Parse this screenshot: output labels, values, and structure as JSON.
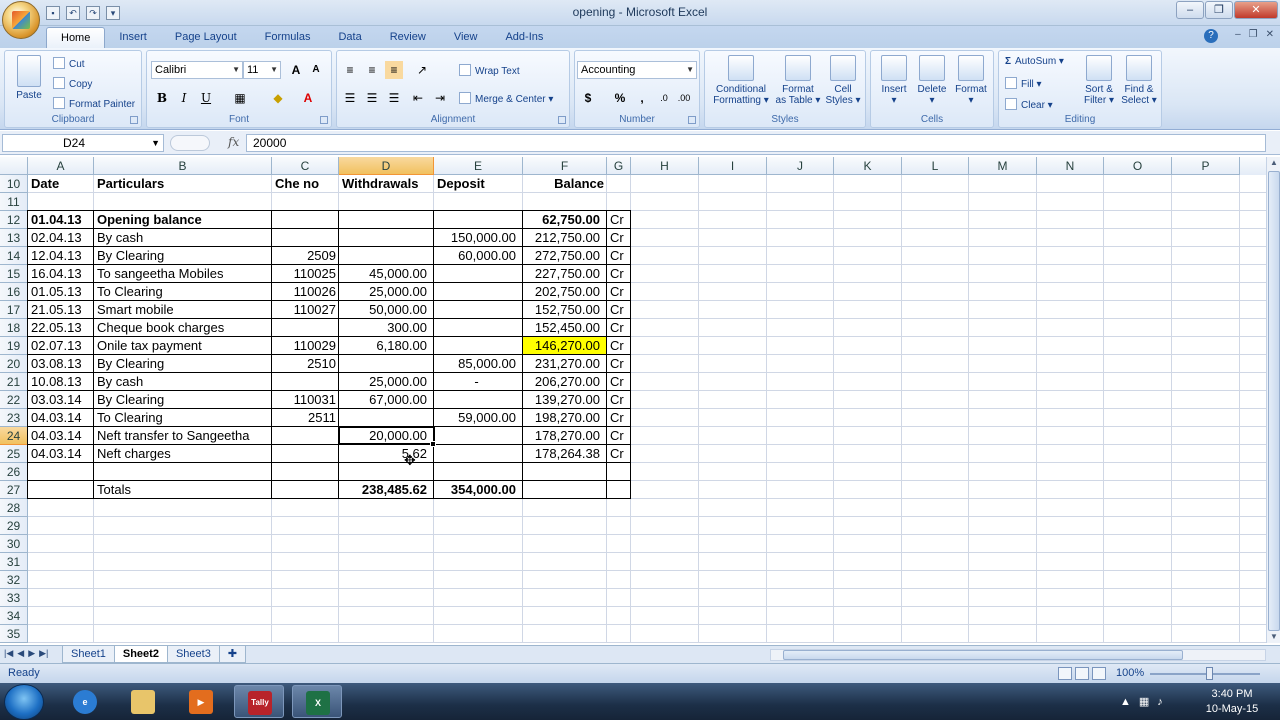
{
  "window": {
    "title": "opening - Microsoft Excel"
  },
  "ribbon_tabs": [
    "Home",
    "Insert",
    "Page Layout",
    "Formulas",
    "Data",
    "Review",
    "View",
    "Add-Ins"
  ],
  "active_tab": "Home",
  "clipboard": {
    "paste": "Paste",
    "cut": "Cut",
    "copy": "Copy",
    "format_painter": "Format Painter",
    "group": "Clipboard"
  },
  "font": {
    "name": "Calibri",
    "size": "11",
    "group": "Font",
    "bold": "B",
    "italic": "I",
    "underline": "U",
    "grow": "A",
    "shrink": "A"
  },
  "alignment": {
    "wrap_text": "Wrap Text",
    "merge_center": "Merge & Center",
    "group": "Alignment"
  },
  "number": {
    "format": "Accounting",
    "currency": "$",
    "percent": "%",
    "comma": ",",
    "group": "Number"
  },
  "styles": {
    "conditional_1": "Conditional",
    "conditional_2": "Formatting",
    "format_table_1": "Format",
    "format_table_2": "as Table",
    "cell_styles_1": "Cell",
    "cell_styles_2": "Styles",
    "group": "Styles"
  },
  "cells_grp": {
    "insert": "Insert",
    "delete": "Delete",
    "format": "Format",
    "group": "Cells"
  },
  "editing": {
    "autosum": "AutoSum",
    "fill": "Fill",
    "clear": "Clear",
    "sort_1": "Sort &",
    "sort_2": "Filter",
    "find_1": "Find &",
    "find_2": "Select",
    "group": "Editing"
  },
  "formula_bar": {
    "name_box": "D24",
    "fx": "fx",
    "content": "20000"
  },
  "columns": [
    "A",
    "B",
    "C",
    "D",
    "E",
    "F",
    "G",
    "H",
    "I",
    "J",
    "K",
    "L",
    "M",
    "N",
    "O",
    "P"
  ],
  "row_numbers": [
    "10",
    "11",
    "12",
    "13",
    "14",
    "15",
    "16",
    "17",
    "18",
    "19",
    "20",
    "21",
    "22",
    "23",
    "24",
    "25",
    "26",
    "27",
    "28",
    "29",
    "30",
    "31",
    "32",
    "33",
    "34",
    "35"
  ],
  "headers": {
    "date": "Date",
    "particulars": "Particulars",
    "che_no": "Che no",
    "withdrawals": "Withdrawals",
    "deposit": "Deposit",
    "balance": "Balance"
  },
  "rows": [
    {
      "r": "12",
      "date": "01.04.13",
      "part": "Opening balance",
      "che": "",
      "wd": "",
      "dep": "",
      "bal": "62,750.00",
      "cr": "Cr",
      "bold": true
    },
    {
      "r": "13",
      "date": "02.04.13",
      "part": "By cash",
      "che": "",
      "wd": "",
      "dep": "150,000.00",
      "bal": "212,750.00",
      "cr": "Cr"
    },
    {
      "r": "14",
      "date": "12.04.13",
      "part": "By Clearing",
      "che": "2509",
      "wd": "",
      "dep": "60,000.00",
      "bal": "272,750.00",
      "cr": "Cr"
    },
    {
      "r": "15",
      "date": "16.04.13",
      "part": "To sangeetha Mobiles",
      "che": "110025",
      "wd": "45,000.00",
      "dep": "",
      "bal": "227,750.00",
      "cr": "Cr"
    },
    {
      "r": "16",
      "date": "01.05.13",
      "part": "To Clearing",
      "che": "110026",
      "wd": "25,000.00",
      "dep": "",
      "bal": "202,750.00",
      "cr": "Cr"
    },
    {
      "r": "17",
      "date": "21.05.13",
      "part": "Smart mobile",
      "che": "110027",
      "wd": "50,000.00",
      "dep": "",
      "bal": "152,750.00",
      "cr": "Cr"
    },
    {
      "r": "18",
      "date": "22.05.13",
      "part": "Cheque book charges",
      "che": "",
      "wd": "300.00",
      "dep": "",
      "bal": "152,450.00",
      "cr": "Cr"
    },
    {
      "r": "19",
      "date": "02.07.13",
      "part": "Onile tax payment",
      "che": "110029",
      "wd": "6,180.00",
      "dep": "",
      "bal": "146,270.00",
      "cr": "Cr",
      "highlight": true
    },
    {
      "r": "20",
      "date": "03.08.13",
      "part": "By Clearing",
      "che": "2510",
      "wd": "",
      "dep": "85,000.00",
      "bal": "231,270.00",
      "cr": "Cr"
    },
    {
      "r": "21",
      "date": "10.08.13",
      "part": "By cash",
      "che": "",
      "wd": "25,000.00",
      "dep": "-",
      "bal": "206,270.00",
      "cr": "Cr"
    },
    {
      "r": "22",
      "date": "03.03.14",
      "part": "By Clearing",
      "che": "110031",
      "wd": "67,000.00",
      "dep": "",
      "bal": "139,270.00",
      "cr": "Cr"
    },
    {
      "r": "23",
      "date": "04.03.14",
      "part": "To Clearing",
      "che": "2511",
      "wd": "",
      "dep": "59,000.00",
      "bal": "198,270.00",
      "cr": "Cr"
    },
    {
      "r": "24",
      "date": "04.03.14",
      "part": "Neft transfer to Sangeetha",
      "che": "",
      "wd": "20,000.00",
      "dep": "",
      "bal": "178,270.00",
      "cr": "Cr"
    },
    {
      "r": "25",
      "date": "04.03.14",
      "part": "Neft charges",
      "che": "",
      "wd": "5.62",
      "dep": "",
      "bal": "178,264.38",
      "cr": "Cr"
    }
  ],
  "totals": {
    "label": "Totals",
    "withdrawals": "238,485.62",
    "deposit": "354,000.00"
  },
  "sheets": [
    "Sheet1",
    "Sheet2",
    "Sheet3"
  ],
  "active_sheet": "Sheet2",
  "status": {
    "text": "Ready",
    "zoom": "100%"
  },
  "taskbar": {
    "time": "3:40 PM",
    "date": "10-May-15",
    "tally": "Tally"
  },
  "colors": {
    "highlight": "#ffff00",
    "selection": "#f1c15f",
    "accent": "#15428b"
  }
}
